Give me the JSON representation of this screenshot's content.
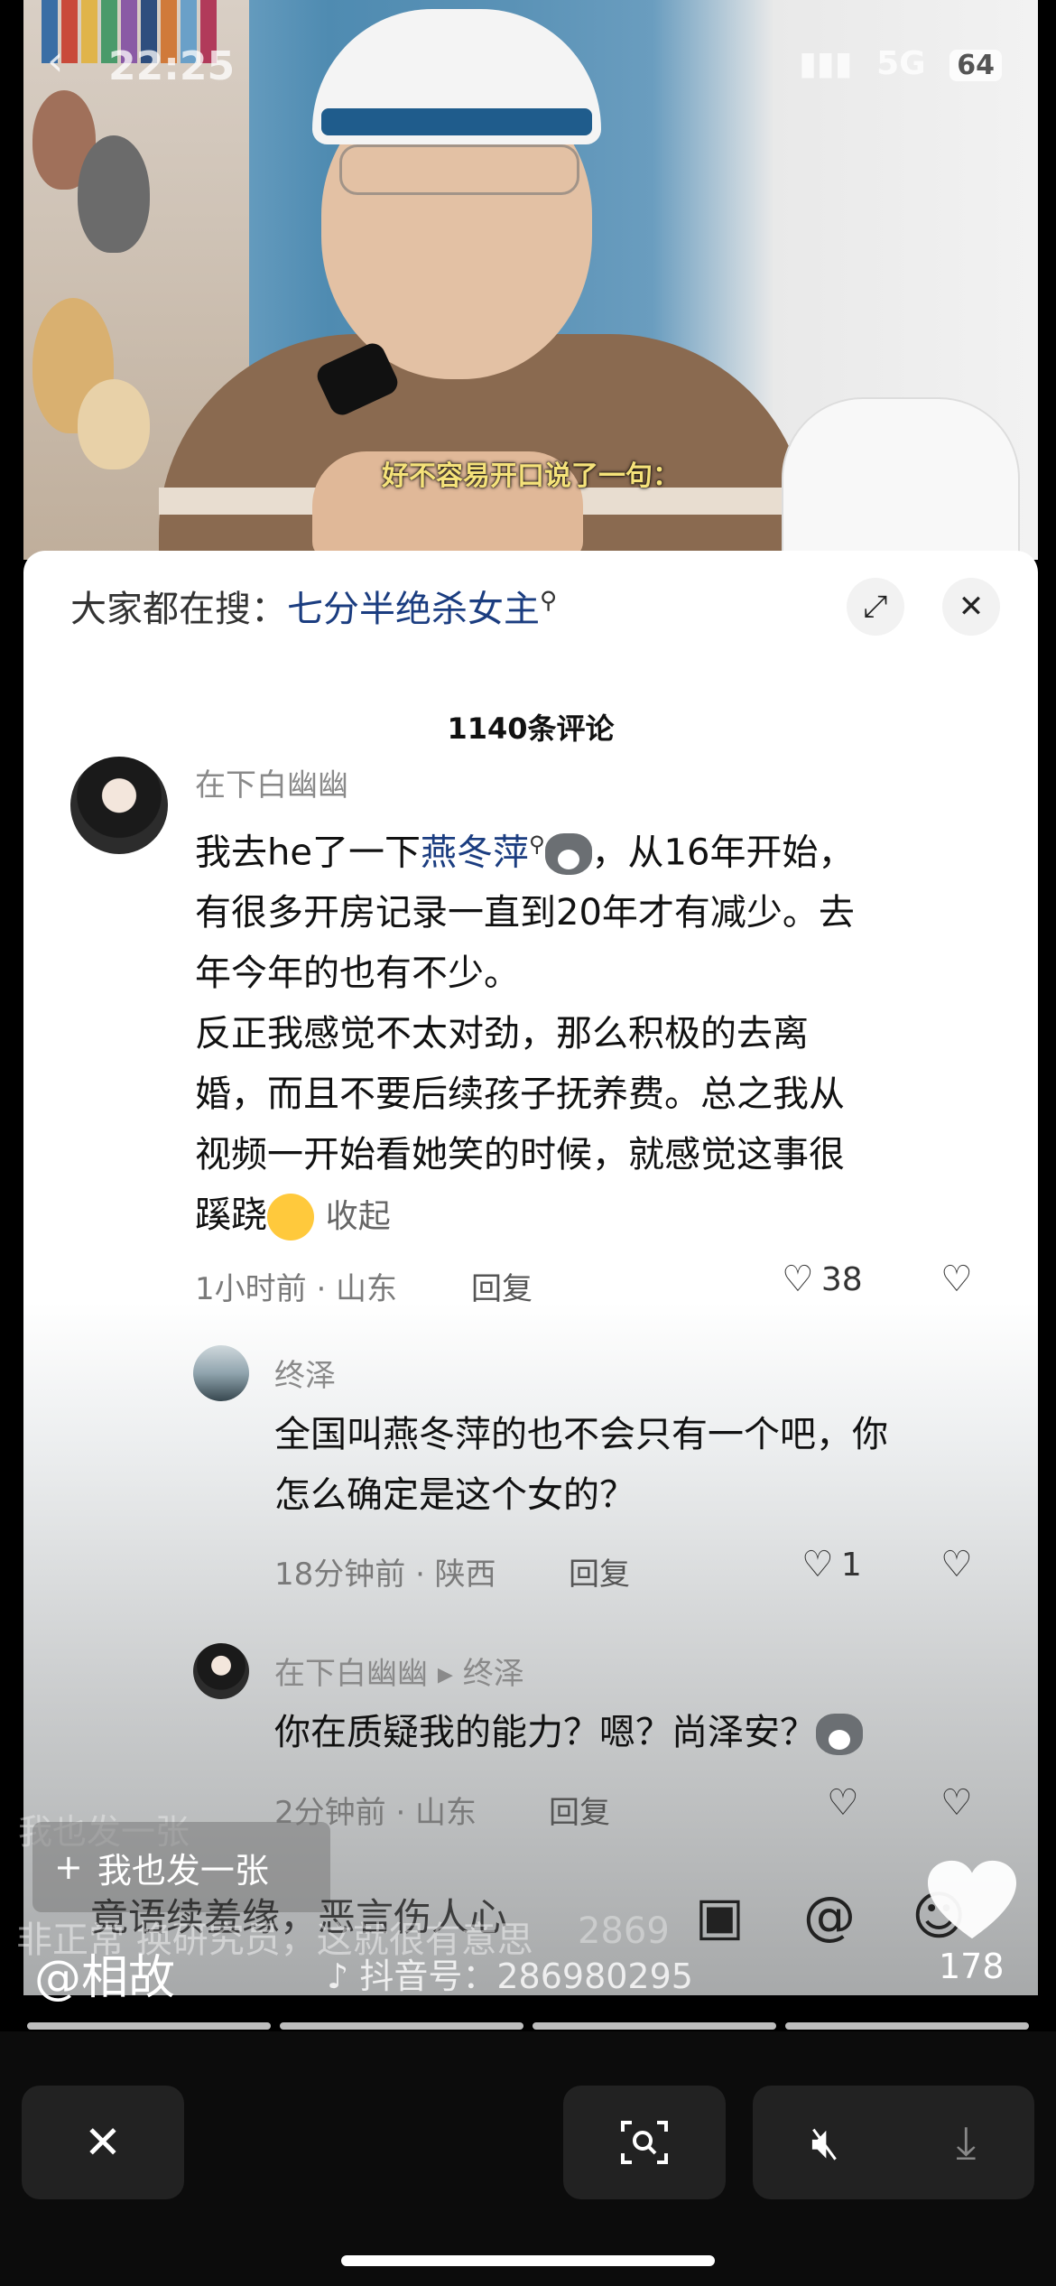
{
  "status_bar": {
    "time": "22:25",
    "signal": "5G",
    "battery": "64"
  },
  "video": {
    "subtitle": "好不容易开口说了一句："
  },
  "sheet": {
    "search_prefix": "大家都在搜：",
    "search_keyword": "七分半绝杀女主",
    "comment_count": "1140条评论"
  },
  "comments": [
    {
      "user": "在下白幽幽",
      "text_parts": [
        "我去he了一下",
        "燕冬萍",
        "，从16年开始，",
        "有很多开房记录一直到20年才有减少。去",
        "年今年的也有不少。",
        "反正我感觉不太对劲，那么积极的去离",
        "婚，而且不要后续孩子抚养费。总之我从",
        "视频一开始看她笑的时候，就感觉这事很",
        "蹊跷"
      ],
      "collapse": "收起",
      "meta": "1小时前 · 山东",
      "reply": "回复",
      "likes": "38"
    },
    {
      "user": "终泽",
      "lines": [
        "全国叫燕冬萍的也不会只有一个吧，你",
        "怎么确定是这个女的？"
      ],
      "meta": "18分钟前 · 陕西",
      "reply": "回复",
      "likes": "1"
    },
    {
      "user": "在下白幽幽",
      "reply_to": "终泽",
      "text": "你在质疑我的能力？嗯？尚泽安？",
      "meta": "2分钟前 · 山东",
      "reply": "回复"
    }
  ],
  "overlay": {
    "post_button": "我也发一张",
    "post_ghost": "我也发一张",
    "input_text": "竟语续羞缘，恶言伤人心",
    "ghost_line": "非正常 换研究员，这就很有意思",
    "ghost_num": "2869",
    "author": "@相故",
    "douyin_id": "抖音号：286980295",
    "heart_count": "178"
  },
  "progress_segments": 4,
  "colors": {
    "link": "#1b3d80",
    "subtitle": "#f5e27a"
  }
}
